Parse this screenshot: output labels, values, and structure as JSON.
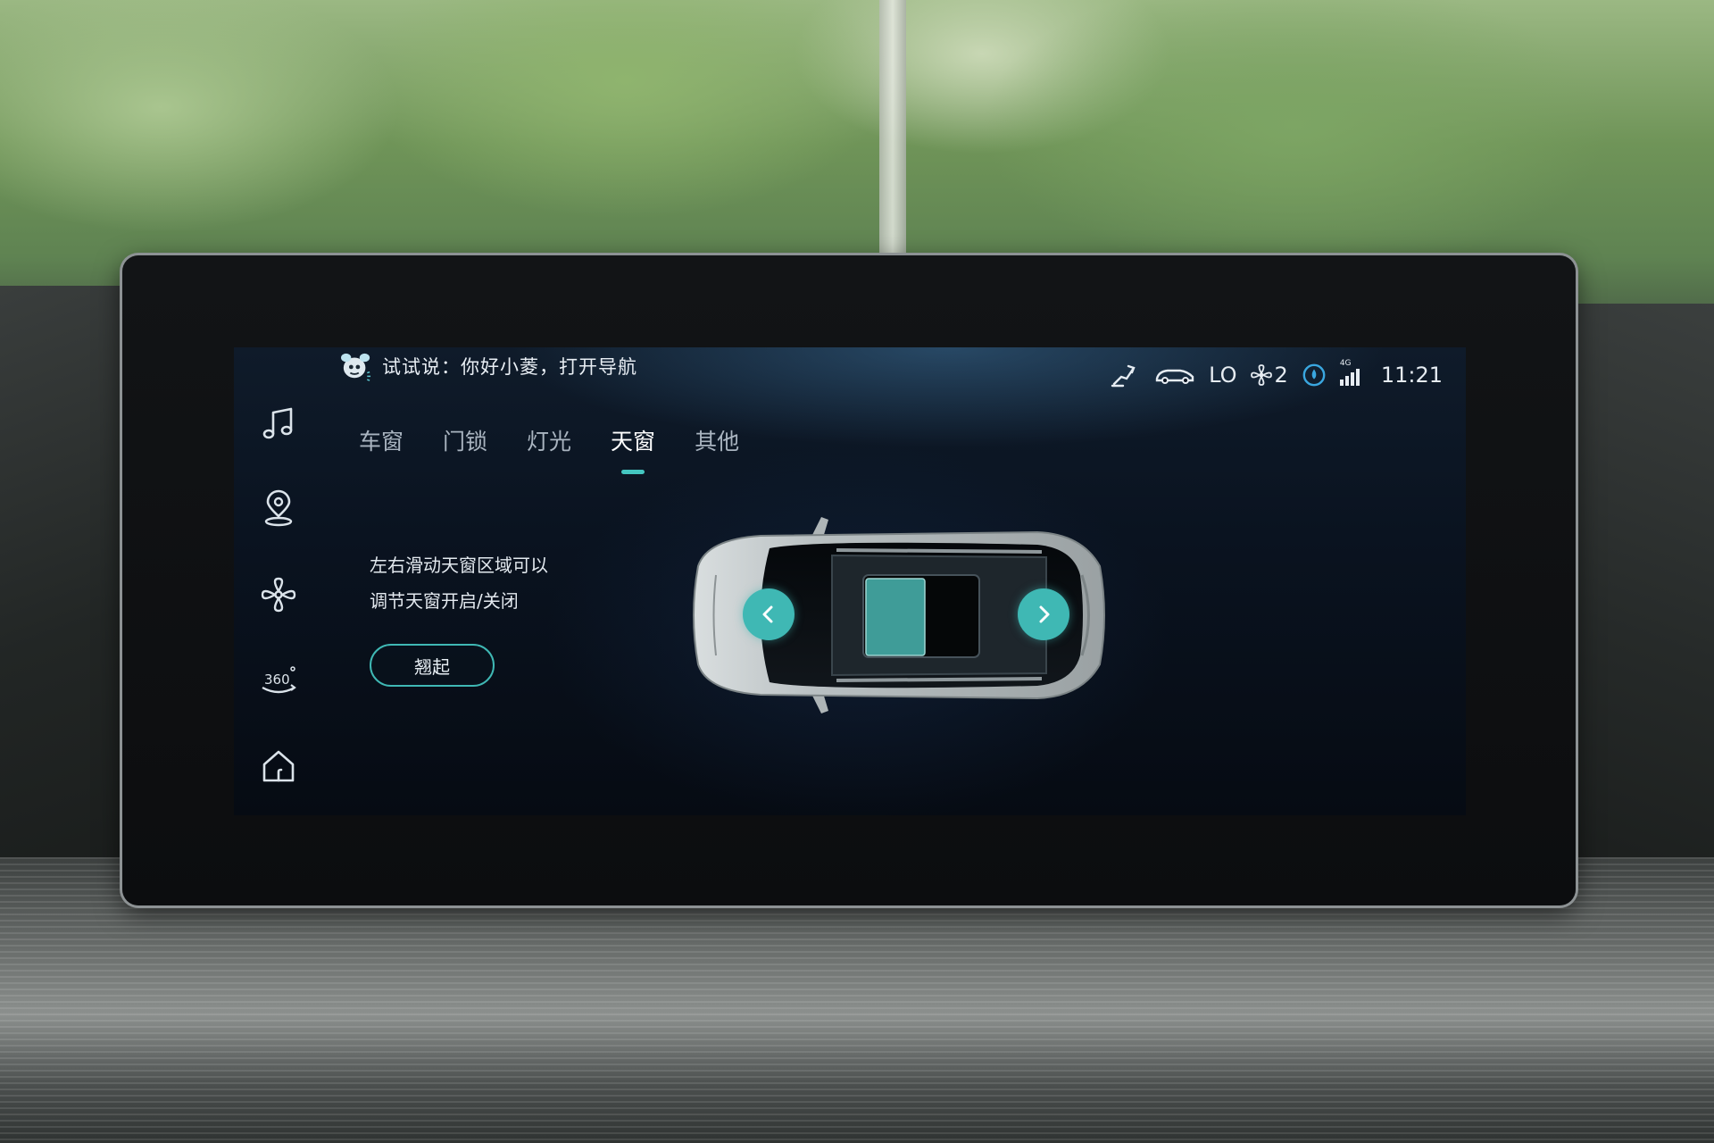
{
  "voice_assistant": {
    "prompt": "试试说：你好小菱，打开导航",
    "icon": "mascot-icon"
  },
  "status_bar": {
    "climate_level": "LO",
    "fan_speed": "2",
    "time": "11:21",
    "network": "4G",
    "icons": [
      "seat-recline-icon",
      "car-airflow-icon",
      "fan-icon",
      "water-drop-icon",
      "signal-icon"
    ]
  },
  "sidebar": {
    "items": [
      {
        "name": "music",
        "icon": "music-note-icon"
      },
      {
        "name": "navigation",
        "icon": "map-pin-icon"
      },
      {
        "name": "climate",
        "icon": "fan-icon"
      },
      {
        "name": "camera-360",
        "icon": "camera-360-icon",
        "label": "360°"
      },
      {
        "name": "home",
        "icon": "home-icon"
      }
    ]
  },
  "tabs": {
    "items": [
      {
        "label": "车窗",
        "active": false
      },
      {
        "label": "门锁",
        "active": false
      },
      {
        "label": "灯光",
        "active": false
      },
      {
        "label": "天窗",
        "active": true
      },
      {
        "label": "其他",
        "active": false
      }
    ]
  },
  "sunroof": {
    "hint_line1": "左右滑动天窗区域可以",
    "hint_line2": "调节天窗开启/关闭",
    "tilt_button": "翘起",
    "left_arrow": "chevron-left-icon",
    "right_arrow": "chevron-right-icon"
  },
  "colors": {
    "accent": "#3fb8b4",
    "screen_bg": "#0a1320",
    "text": "#e3e9ef"
  }
}
